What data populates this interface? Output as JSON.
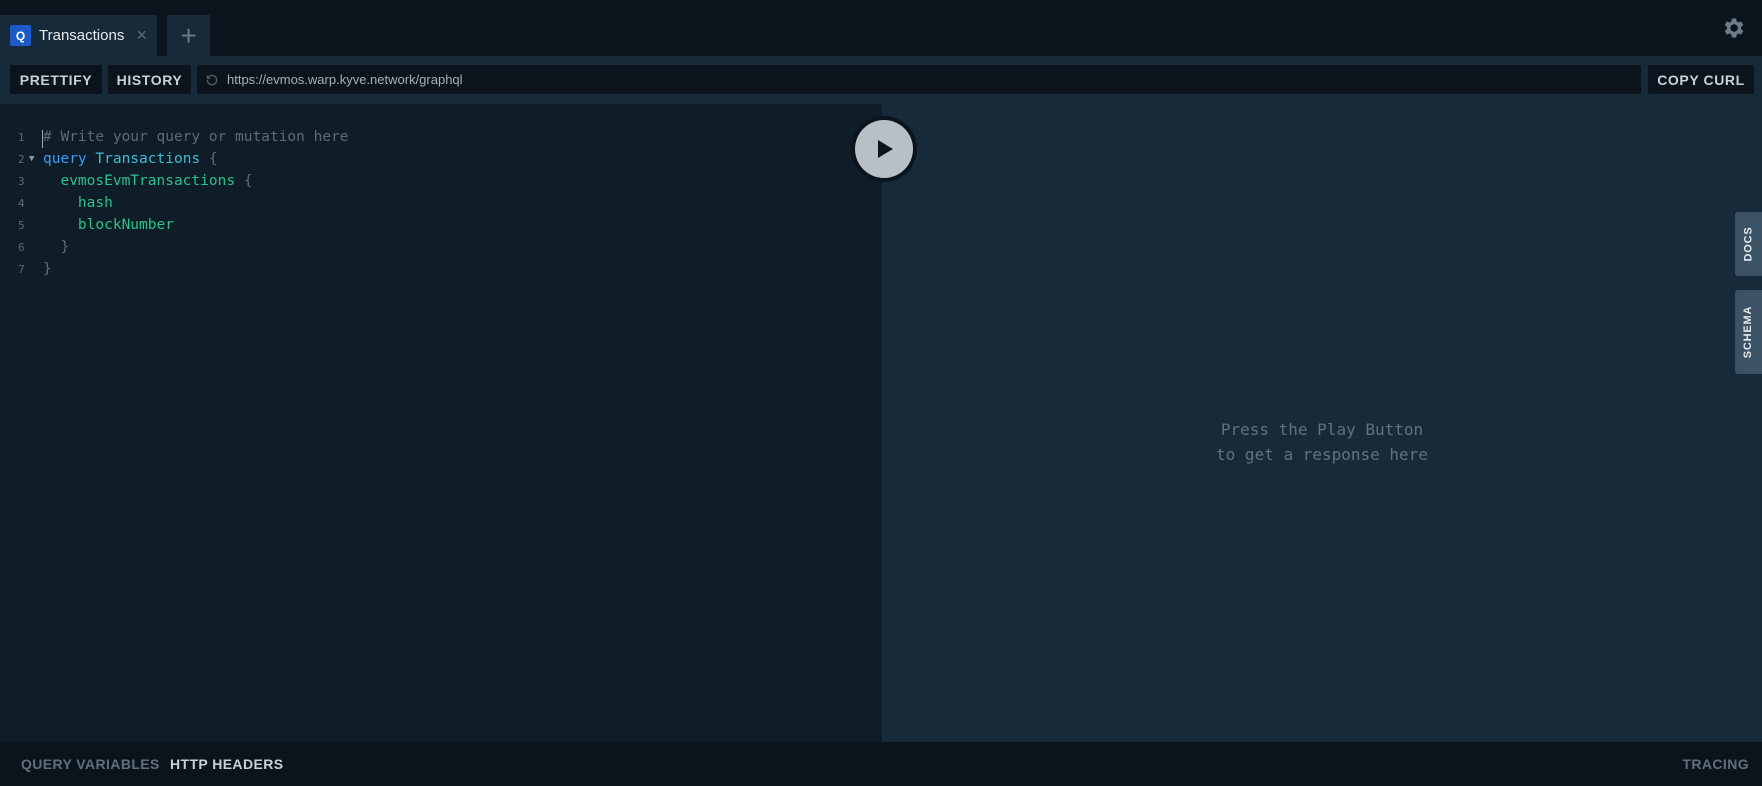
{
  "tabs": [
    {
      "badge": "Q",
      "label": "Transactions",
      "close": "×"
    }
  ],
  "new_tab_label": "+",
  "toolbar": {
    "prettify": "PRETTIFY",
    "history": "HISTORY",
    "endpoint": "https://evmos.warp.kyve.network/graphql",
    "copy_curl": "COPY CURL"
  },
  "editor": {
    "lines": [
      {
        "n": "1",
        "text": "# Write your query or mutation here"
      },
      {
        "n": "2",
        "kw": "query",
        "name": "Transactions",
        "brace": "{"
      },
      {
        "n": "3",
        "field": "evmosEvmTransactions",
        "brace": "{"
      },
      {
        "n": "4",
        "field": "hash"
      },
      {
        "n": "5",
        "field": "blockNumber"
      },
      {
        "n": "6",
        "brace": "}"
      },
      {
        "n": "7",
        "brace": "}"
      }
    ]
  },
  "result": {
    "hint_line1": "Press the Play Button",
    "hint_line2": "to get a response here"
  },
  "side_tabs": {
    "docs": "DOCS",
    "schema": "SCHEMA"
  },
  "bottom": {
    "query_variables": "QUERY VARIABLES",
    "http_headers": "HTTP HEADERS",
    "tracing": "TRACING"
  },
  "colors": {
    "accent": "#1e5ac6",
    "keyword": "#3d9cf5",
    "definition": "#42bbd1",
    "field": "#2fbf8a",
    "comment": "#5b6b78"
  },
  "icons": [
    "gear-icon",
    "reload-icon",
    "play-icon",
    "fold-arrow-icon"
  ]
}
